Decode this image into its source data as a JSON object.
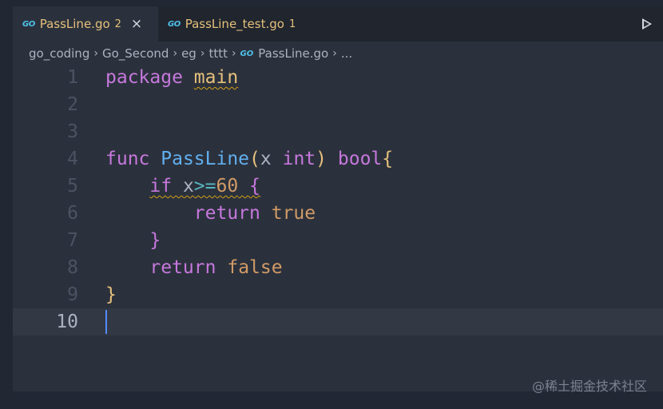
{
  "tabs": [
    {
      "icon": "go-file-icon",
      "glyph": "GO",
      "label": "PassLine.go",
      "badge": "2",
      "active": true,
      "close": "×"
    },
    {
      "icon": "go-file-icon",
      "glyph": "GO",
      "label": "PassLine_test.go",
      "badge": "1",
      "active": false
    }
  ],
  "actions": {
    "run_icon": "run-icon"
  },
  "breadcrumb": {
    "items": [
      "go_coding",
      "Go_Second",
      "eg",
      "tttt",
      "PassLine.go",
      "..."
    ],
    "separator": "›",
    "file_glyph": "GO"
  },
  "editor": {
    "line_numbers": [
      "1",
      "2",
      "3",
      "4",
      "5",
      "6",
      "7",
      "8",
      "9",
      "10"
    ],
    "current_line": "10",
    "lines": [
      {
        "tokens": [
          {
            "t": "package",
            "c": "kw"
          },
          {
            "t": " ",
            "c": ""
          },
          {
            "t": "main",
            "c": "pkg squiggle"
          }
        ]
      },
      {
        "tokens": []
      },
      {
        "tokens": []
      },
      {
        "tokens": [
          {
            "t": "func",
            "c": "kw"
          },
          {
            "t": " ",
            "c": ""
          },
          {
            "t": "PassLine",
            "c": "fn"
          },
          {
            "t": "(",
            "c": "brace-y"
          },
          {
            "t": "x",
            "c": "param"
          },
          {
            "t": " ",
            "c": ""
          },
          {
            "t": "int",
            "c": "typ"
          },
          {
            "t": ")",
            "c": "brace-y"
          },
          {
            "t": " ",
            "c": ""
          },
          {
            "t": "bool",
            "c": "typ"
          },
          {
            "t": "{",
            "c": "brace-y"
          }
        ]
      },
      {
        "tokens": [
          {
            "t": "    ",
            "c": ""
          },
          {
            "t": "if x",
            "c": "sq-kw"
          },
          {
            "t": ">=",
            "c": "op squiggle"
          },
          {
            "t": "60",
            "c": "num squiggle"
          },
          {
            "t": " ",
            "c": "squiggle"
          },
          {
            "t": "{",
            "c": "brace-p squiggle"
          }
        ]
      },
      {
        "tokens": [
          {
            "t": "        ",
            "c": ""
          },
          {
            "t": "return",
            "c": "kw"
          },
          {
            "t": " ",
            "c": ""
          },
          {
            "t": "true",
            "c": "lit"
          }
        ]
      },
      {
        "tokens": [
          {
            "t": "    ",
            "c": ""
          },
          {
            "t": "}",
            "c": "brace-p"
          }
        ]
      },
      {
        "tokens": [
          {
            "t": "    ",
            "c": ""
          },
          {
            "t": "return",
            "c": "kw"
          },
          {
            "t": " ",
            "c": ""
          },
          {
            "t": "false",
            "c": "lit"
          }
        ]
      },
      {
        "tokens": [
          {
            "t": "}",
            "c": "brace-y"
          }
        ]
      },
      {
        "tokens": []
      }
    ]
  },
  "watermark": "@稀土掘金技术社区"
}
